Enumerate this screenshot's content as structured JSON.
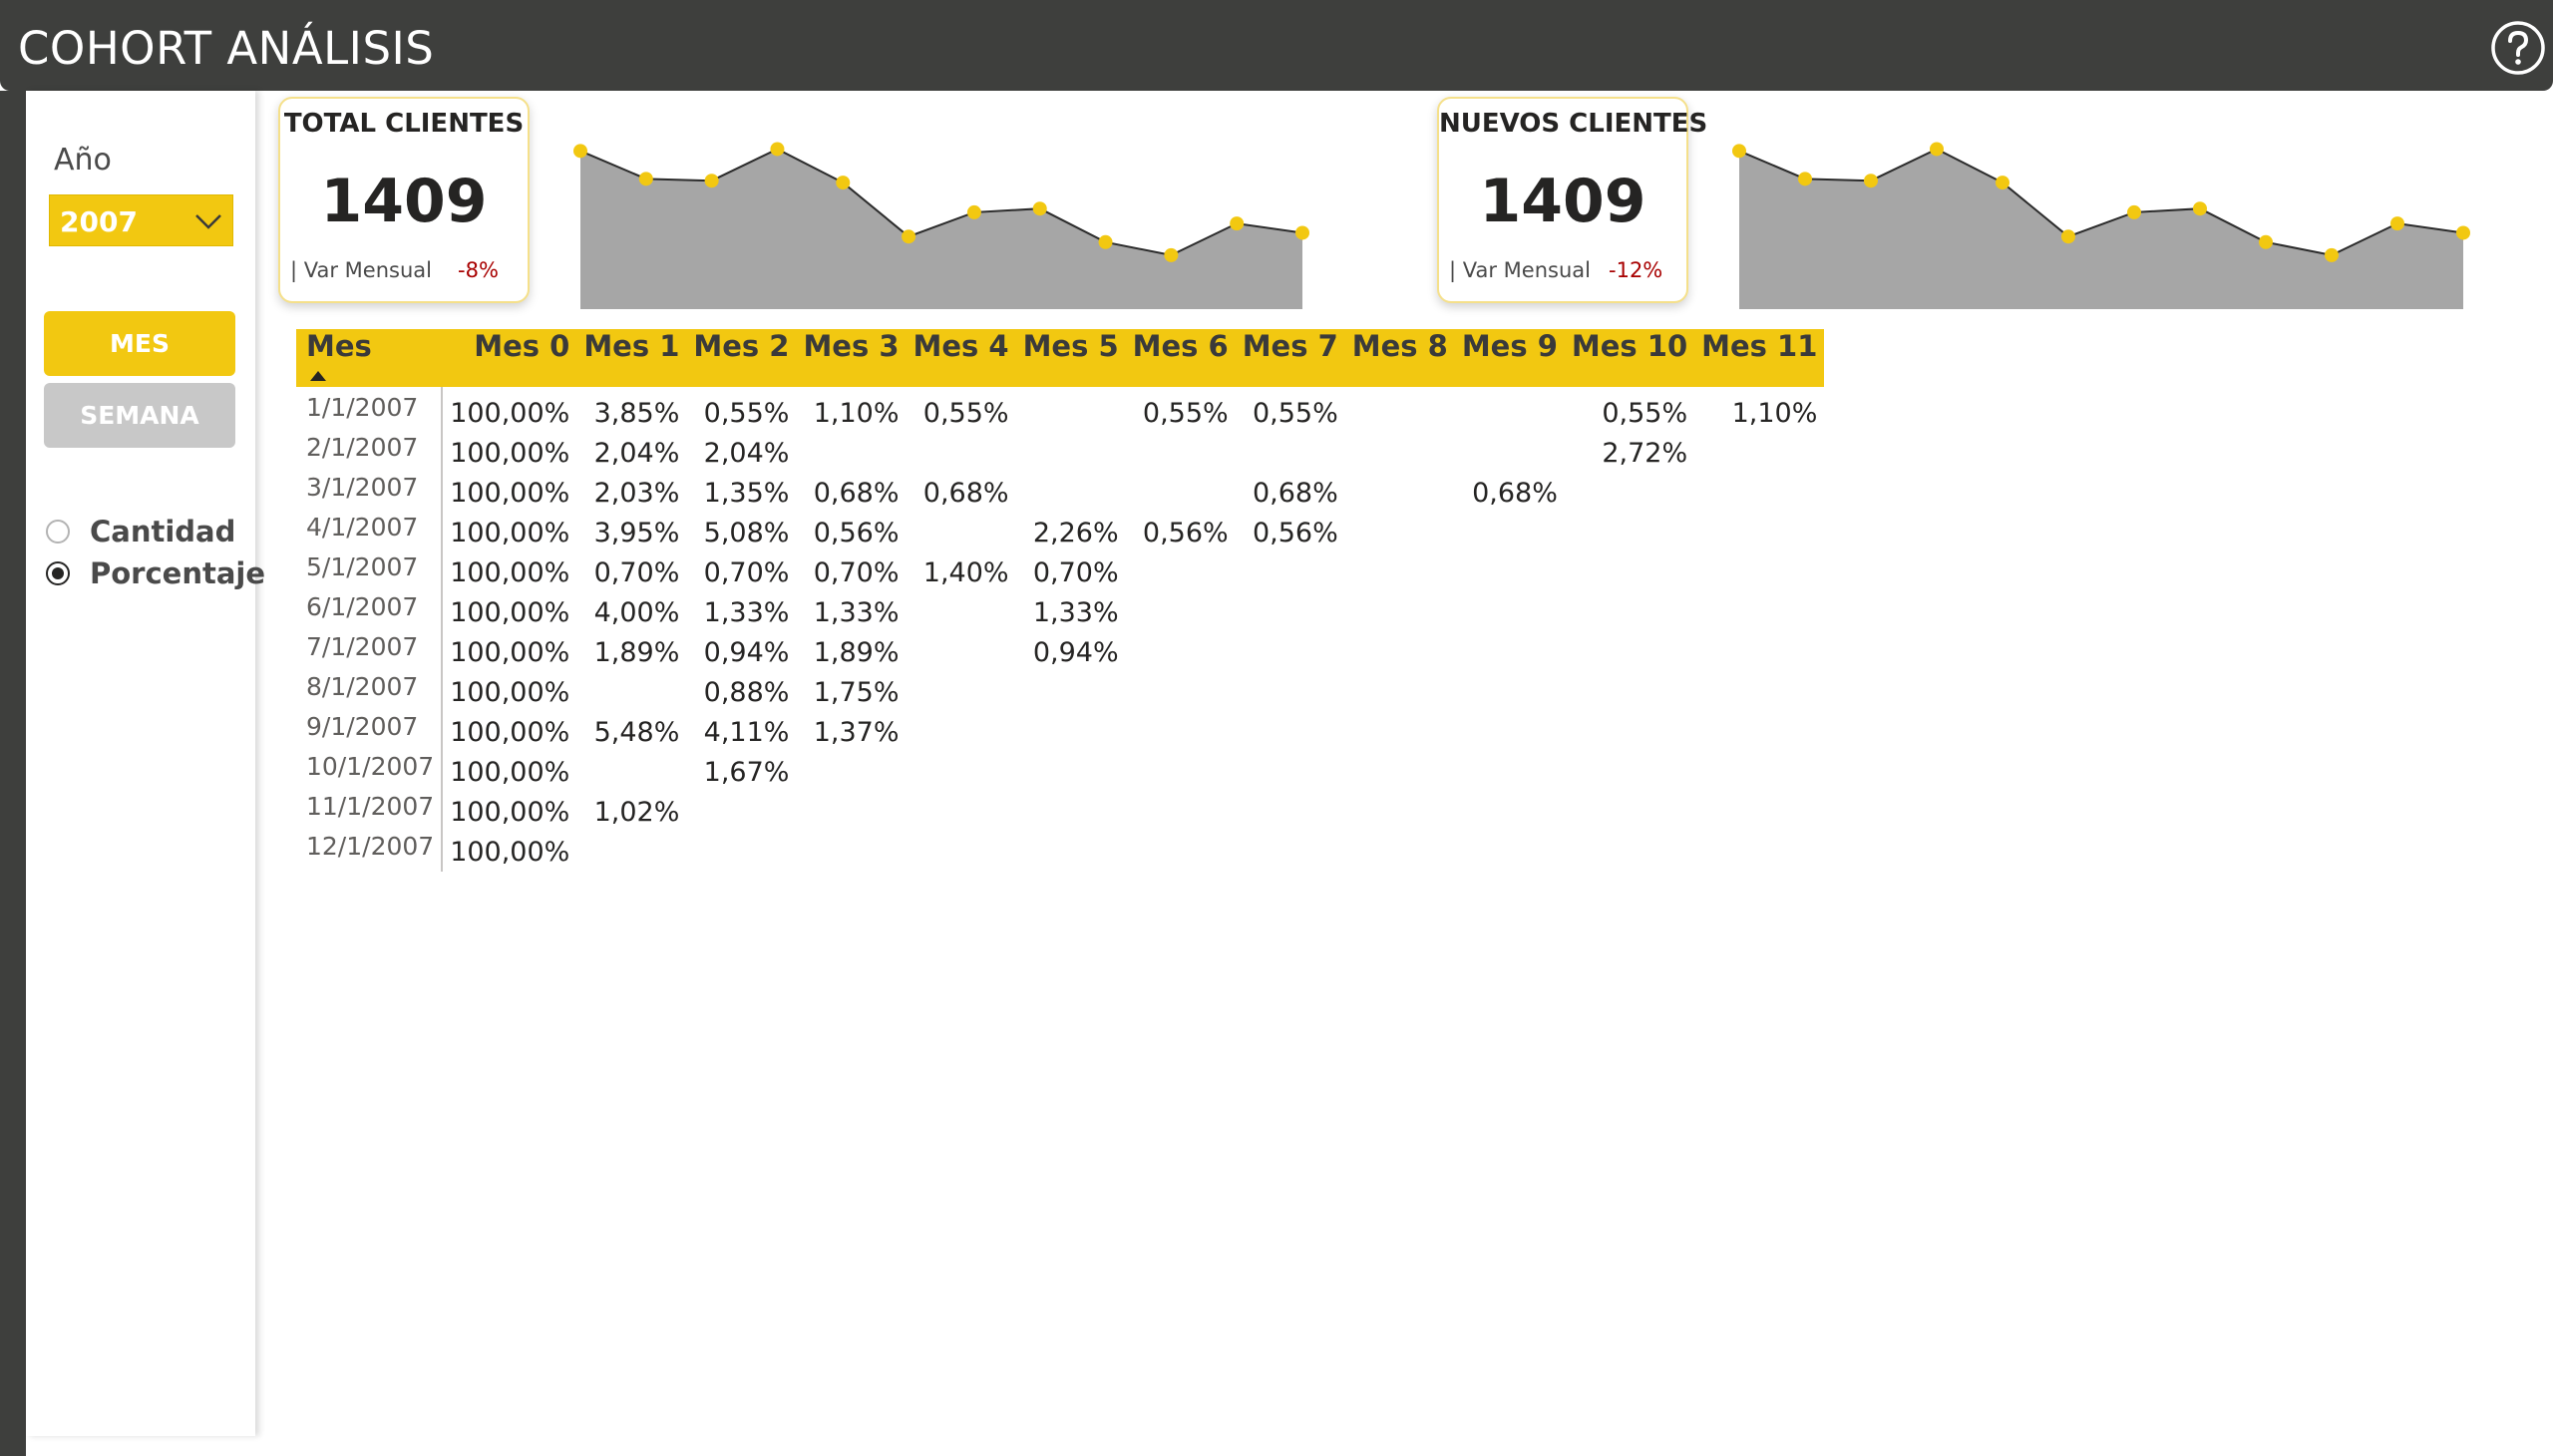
{
  "header": {
    "title": "COHORT ANÁLISIS",
    "help_icon": "question-circle-icon"
  },
  "filters": {
    "year_label": "Año",
    "year_value": "2007",
    "period_buttons": {
      "mes": "MES",
      "semana": "SEMANA"
    },
    "measure_options": [
      {
        "label": "Cantidad",
        "selected": false
      },
      {
        "label": "Porcentaje",
        "selected": true
      }
    ]
  },
  "kpis": {
    "total_clientes": {
      "title": "TOTAL CLIENTES",
      "value": "1409",
      "var_label": "| Var Mensual",
      "var_value": "-8%"
    },
    "nuevos_clientes": {
      "title": "NUEVOS CLIENTES",
      "value": "1409",
      "var_label": "| Var Mensual",
      "var_value": "-12%"
    }
  },
  "colors": {
    "accent": "#f2c811",
    "header_bg": "#3e3f3d",
    "negative": "#a80000",
    "spark_fill": "#a6a6a6"
  },
  "chart_data": [
    {
      "type": "area",
      "name": "total_clientes_trend",
      "x": [
        1,
        2,
        3,
        4,
        5,
        6,
        7,
        8,
        9,
        10,
        11,
        12
      ],
      "values": [
        130,
        115,
        114,
        131,
        113,
        84,
        97,
        99,
        81,
        74,
        91,
        86
      ],
      "ylim": [
        60,
        135
      ]
    },
    {
      "type": "area",
      "name": "nuevos_clientes_trend",
      "x": [
        1,
        2,
        3,
        4,
        5,
        6,
        7,
        8,
        9,
        10,
        11,
        12
      ],
      "values": [
        130,
        115,
        114,
        131,
        113,
        84,
        97,
        99,
        81,
        74,
        91,
        86
      ],
      "ylim": [
        60,
        135
      ]
    }
  ],
  "matrix": {
    "row_header": "Mes",
    "columns": [
      "Mes 0",
      "Mes 1",
      "Mes 2",
      "Mes 3",
      "Mes 4",
      "Mes 5",
      "Mes 6",
      "Mes 7",
      "Mes 8",
      "Mes 9",
      "Mes 10",
      "Mes 11"
    ],
    "rows": [
      {
        "label": "1/1/2007",
        "cells": [
          "100,00%",
          "3,85%",
          "0,55%",
          "1,10%",
          "0,55%",
          "",
          "0,55%",
          "0,55%",
          "",
          "",
          "0,55%",
          "1,10%"
        ]
      },
      {
        "label": "2/1/2007",
        "cells": [
          "100,00%",
          "2,04%",
          "2,04%",
          "",
          "",
          "",
          "",
          "",
          "",
          "",
          "2,72%",
          ""
        ]
      },
      {
        "label": "3/1/2007",
        "cells": [
          "100,00%",
          "2,03%",
          "1,35%",
          "0,68%",
          "0,68%",
          "",
          "",
          "0,68%",
          "",
          "0,68%",
          "",
          ""
        ]
      },
      {
        "label": "4/1/2007",
        "cells": [
          "100,00%",
          "3,95%",
          "5,08%",
          "0,56%",
          "",
          "2,26%",
          "0,56%",
          "0,56%",
          "",
          "",
          "",
          ""
        ]
      },
      {
        "label": "5/1/2007",
        "cells": [
          "100,00%",
          "0,70%",
          "0,70%",
          "0,70%",
          "1,40%",
          "0,70%",
          "",
          "",
          "",
          "",
          "",
          ""
        ]
      },
      {
        "label": "6/1/2007",
        "cells": [
          "100,00%",
          "4,00%",
          "1,33%",
          "1,33%",
          "",
          "1,33%",
          "",
          "",
          "",
          "",
          "",
          ""
        ]
      },
      {
        "label": "7/1/2007",
        "cells": [
          "100,00%",
          "1,89%",
          "0,94%",
          "1,89%",
          "",
          "0,94%",
          "",
          "",
          "",
          "",
          "",
          ""
        ]
      },
      {
        "label": "8/1/2007",
        "cells": [
          "100,00%",
          "",
          "0,88%",
          "1,75%",
          "",
          "",
          "",
          "",
          "",
          "",
          "",
          ""
        ]
      },
      {
        "label": "9/1/2007",
        "cells": [
          "100,00%",
          "5,48%",
          "4,11%",
          "1,37%",
          "",
          "",
          "",
          "",
          "",
          "",
          "",
          ""
        ]
      },
      {
        "label": "10/1/2007",
        "cells": [
          "100,00%",
          "",
          "1,67%",
          "",
          "",
          "",
          "",
          "",
          "",
          "",
          "",
          ""
        ]
      },
      {
        "label": "11/1/2007",
        "cells": [
          "100,00%",
          "1,02%",
          "",
          "",
          "",
          "",
          "",
          "",
          "",
          "",
          "",
          ""
        ]
      },
      {
        "label": "12/1/2007",
        "cells": [
          "100,00%",
          "",
          "",
          "",
          "",
          "",
          "",
          "",
          "",
          "",
          "",
          ""
        ]
      }
    ]
  }
}
